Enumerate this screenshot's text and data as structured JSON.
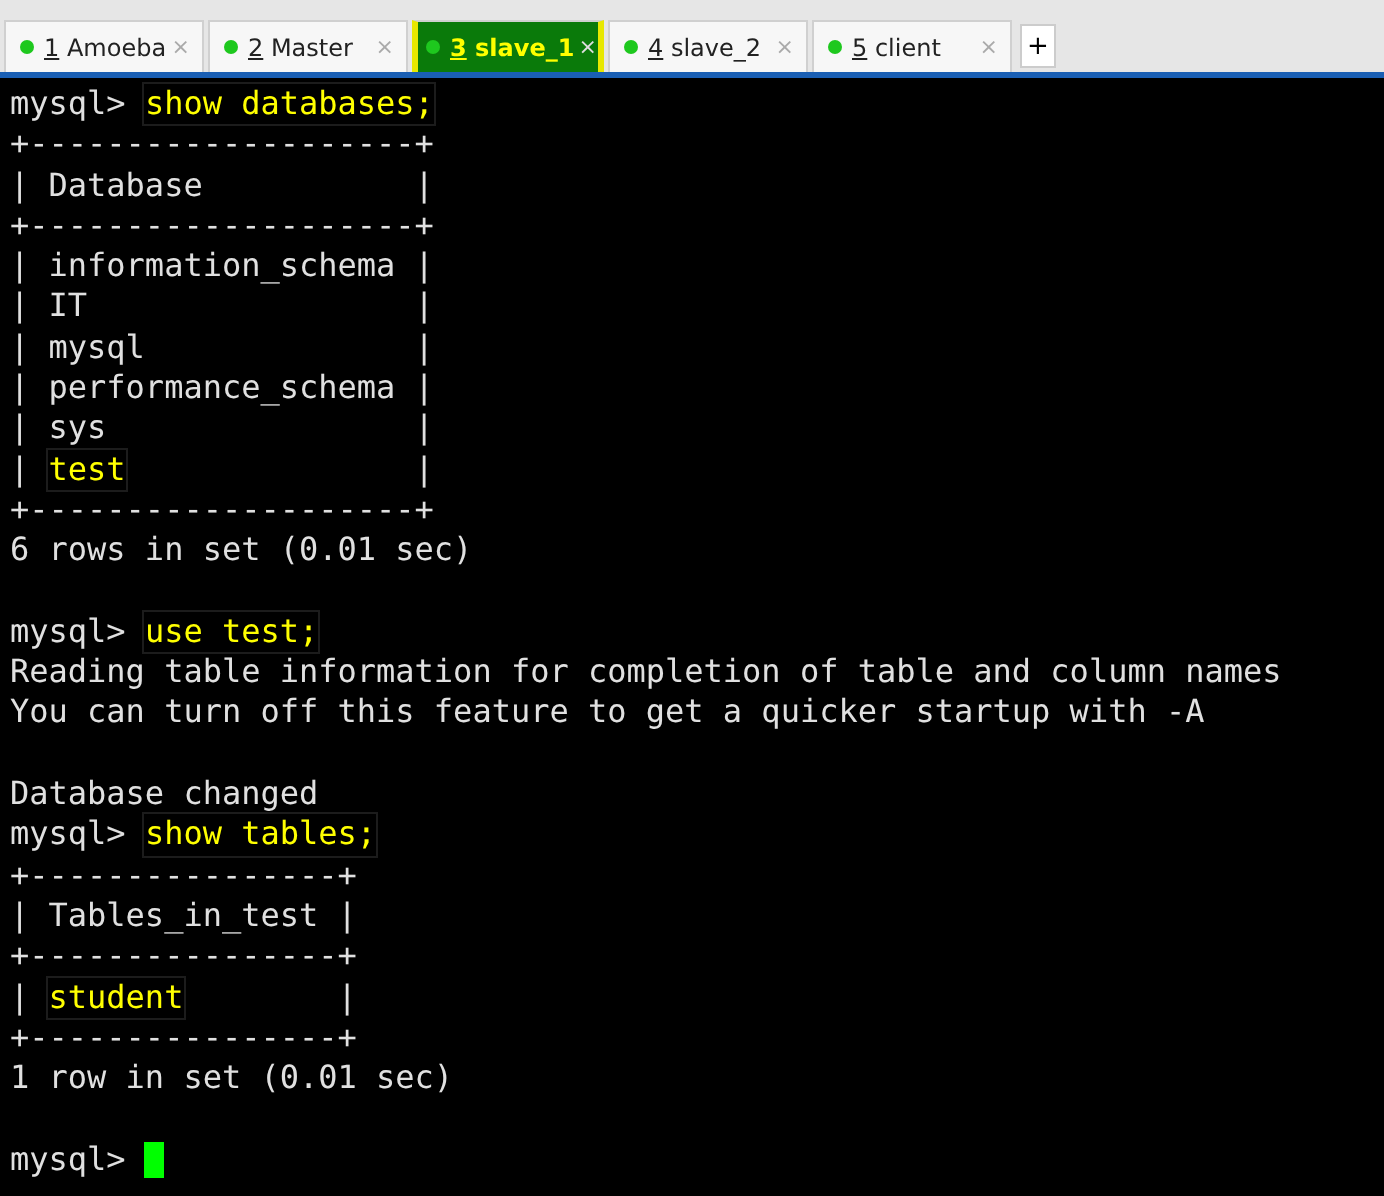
{
  "tabs": [
    {
      "number": "1",
      "label": "Amoeba",
      "selected": false,
      "close": "×"
    },
    {
      "number": "2",
      "label": "Master",
      "selected": false,
      "close": "×"
    },
    {
      "number": "3",
      "label": "slave_1",
      "selected": true,
      "close": "×"
    },
    {
      "number": "4",
      "label": "slave_2",
      "selected": false,
      "close": "×"
    },
    {
      "number": "5",
      "label": "client",
      "selected": false,
      "close": "×"
    }
  ],
  "new_tab": "+",
  "terminal": {
    "lines": [
      {
        "kind": "text",
        "segments": [
          {
            "text": "mysql> ",
            "highlight": false
          },
          {
            "text": "show databases;",
            "highlight": true
          }
        ]
      },
      {
        "kind": "text",
        "segments": [
          {
            "text": "+--------------------+",
            "highlight": false
          }
        ]
      },
      {
        "kind": "text",
        "segments": [
          {
            "text": "| Database           |",
            "highlight": false
          }
        ]
      },
      {
        "kind": "text",
        "segments": [
          {
            "text": "+--------------------+",
            "highlight": false
          }
        ]
      },
      {
        "kind": "text",
        "segments": [
          {
            "text": "| information_schema |",
            "highlight": false
          }
        ]
      },
      {
        "kind": "text",
        "segments": [
          {
            "text": "| IT                 |",
            "highlight": false
          }
        ]
      },
      {
        "kind": "text",
        "segments": [
          {
            "text": "| mysql              |",
            "highlight": false
          }
        ]
      },
      {
        "kind": "text",
        "segments": [
          {
            "text": "| performance_schema |",
            "highlight": false
          }
        ]
      },
      {
        "kind": "text",
        "segments": [
          {
            "text": "| sys                |",
            "highlight": false
          }
        ]
      },
      {
        "kind": "text",
        "segments": [
          {
            "text": "| ",
            "highlight": false
          },
          {
            "text": "test",
            "highlight": true
          },
          {
            "text": "               |",
            "highlight": false
          }
        ]
      },
      {
        "kind": "text",
        "segments": [
          {
            "text": "+--------------------+",
            "highlight": false
          }
        ]
      },
      {
        "kind": "text",
        "segments": [
          {
            "text": "6 rows in set (0.01 sec)",
            "highlight": false
          }
        ]
      },
      {
        "kind": "blank"
      },
      {
        "kind": "text",
        "segments": [
          {
            "text": "mysql> ",
            "highlight": false
          },
          {
            "text": "use test;",
            "highlight": true
          }
        ]
      },
      {
        "kind": "text",
        "segments": [
          {
            "text": "Reading table information for completion of table and column names",
            "highlight": false
          }
        ]
      },
      {
        "kind": "text",
        "segments": [
          {
            "text": "You can turn off this feature to get a quicker startup with -A",
            "highlight": false
          }
        ]
      },
      {
        "kind": "blank"
      },
      {
        "kind": "text",
        "segments": [
          {
            "text": "Database changed",
            "highlight": false
          }
        ]
      },
      {
        "kind": "text",
        "segments": [
          {
            "text": "mysql> ",
            "highlight": false
          },
          {
            "text": "show tables;",
            "highlight": true
          }
        ]
      },
      {
        "kind": "text",
        "segments": [
          {
            "text": "+----------------+",
            "highlight": false
          }
        ]
      },
      {
        "kind": "text",
        "segments": [
          {
            "text": "| Tables_in_test |",
            "highlight": false
          }
        ]
      },
      {
        "kind": "text",
        "segments": [
          {
            "text": "+----------------+",
            "highlight": false
          }
        ]
      },
      {
        "kind": "text",
        "segments": [
          {
            "text": "| ",
            "highlight": false
          },
          {
            "text": "student",
            "highlight": true
          },
          {
            "text": "        |",
            "highlight": false
          }
        ]
      },
      {
        "kind": "text",
        "segments": [
          {
            "text": "+----------------+",
            "highlight": false
          }
        ]
      },
      {
        "kind": "text",
        "segments": [
          {
            "text": "1 row in set (0.01 sec)",
            "highlight": false
          }
        ]
      },
      {
        "kind": "blank"
      },
      {
        "kind": "prompt",
        "segments": [
          {
            "text": "mysql> ",
            "highlight": false
          }
        ],
        "cursor": true
      }
    ]
  }
}
